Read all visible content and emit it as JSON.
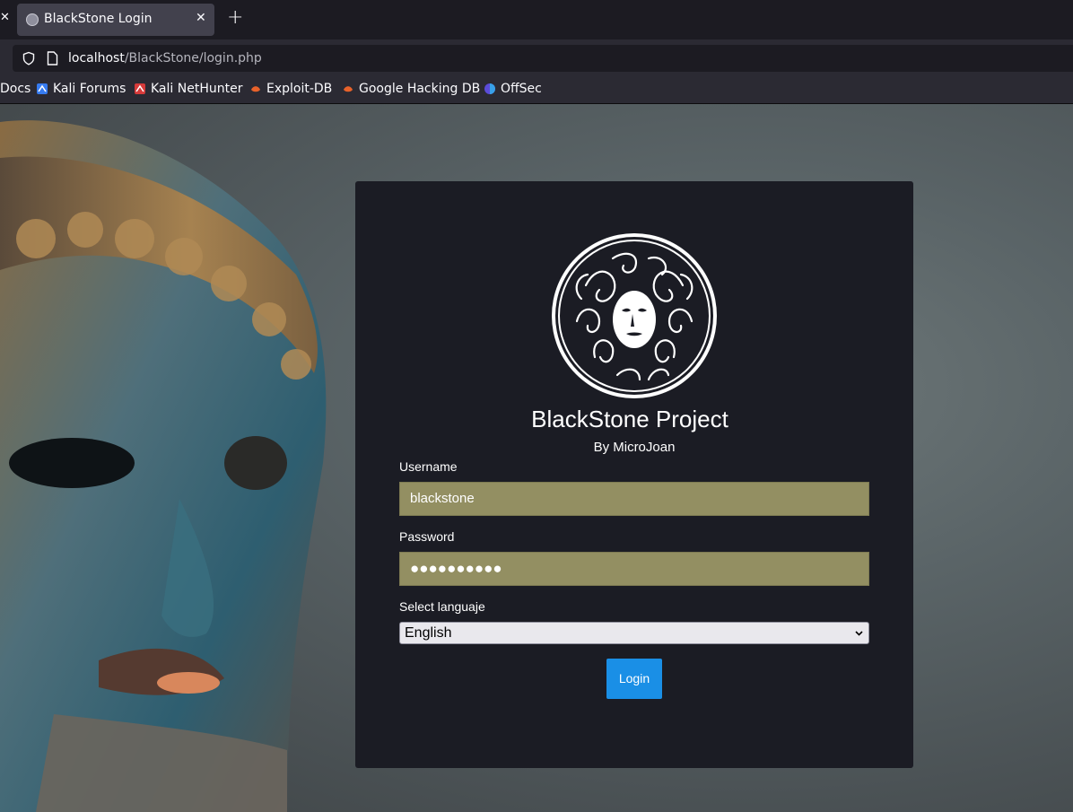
{
  "browser": {
    "tab": {
      "title": "BlackStone Login",
      "close_glyph": "✕"
    },
    "left_edge_glyph": "✕",
    "new_tab_glyph": "+",
    "url": {
      "host": "localhost",
      "path": "/BlackStone/login.php"
    },
    "bookmarks": [
      {
        "label": "Docs",
        "icon": "none"
      },
      {
        "label": "Kali Forums",
        "icon": "kali-forums-icon"
      },
      {
        "label": "Kali NetHunter",
        "icon": "kali-nethunter-icon"
      },
      {
        "label": "Exploit-DB",
        "icon": "exploit-db-icon"
      },
      {
        "label": "Google Hacking DB",
        "icon": "ghdb-icon"
      },
      {
        "label": "OffSec",
        "icon": "offsec-icon"
      }
    ]
  },
  "login": {
    "title": "BlackStone Project",
    "byline": "By MicroJoan",
    "username_label": "Username",
    "username_value": "blackstone",
    "password_label": "Password",
    "password_value": "●●●●●●●●●●",
    "language_label": "Select languaje",
    "language_value": "English",
    "submit_label": "Login"
  },
  "colors": {
    "card_bg": "#1b1c24",
    "field_bg": "#938f62",
    "button_bg": "#1a8fe6",
    "browser_chrome": "#2b2a33"
  }
}
